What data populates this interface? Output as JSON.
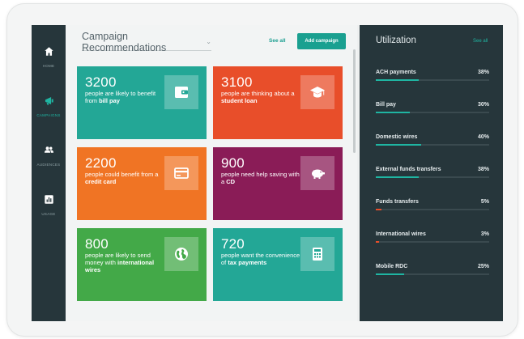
{
  "sidebar": {
    "items": [
      {
        "label": "HOME",
        "icon": "home-icon"
      },
      {
        "label": "CAMPAIGNS",
        "icon": "campaign-icon"
      },
      {
        "label": "AUDIENCES",
        "icon": "audience-icon"
      },
      {
        "label": "USAGE",
        "icon": "usage-icon"
      }
    ]
  },
  "main": {
    "title": "Campaign Recommendations",
    "see_all": "See all",
    "add_button": "Add campaign",
    "cards": [
      {
        "number": "3200",
        "text_pre": "people are likely to benefit from ",
        "text_bold": "bill pay",
        "text_post": "",
        "color": "#23a796",
        "icon": "wallet-icon"
      },
      {
        "number": "3100",
        "text_pre": "people are thinking about a ",
        "text_bold": "student loan",
        "text_post": "",
        "color": "#e84e2a",
        "icon": "graduation-cap-icon"
      },
      {
        "number": "2200",
        "text_pre": "people could benefit from a ",
        "text_bold": "credit card",
        "text_post": "",
        "color": "#f07424",
        "icon": "credit-card-icon"
      },
      {
        "number": "900",
        "text_pre": "people need help saving with a ",
        "text_bold": "CD",
        "text_post": "",
        "color": "#8a1c57",
        "icon": "piggy-bank-icon"
      },
      {
        "number": "800",
        "text_pre": "people are likely to send money with ",
        "text_bold": "international wires",
        "text_post": "",
        "color": "#43a948",
        "icon": "globe-icon"
      },
      {
        "number": "720",
        "text_pre": "people want the convenience of ",
        "text_bold": "tax payments",
        "text_post": "",
        "color": "#23a796",
        "icon": "calculator-icon"
      }
    ]
  },
  "utilization": {
    "title": "Utilization",
    "see_all": "See all",
    "rows": [
      {
        "label": "ACH payments",
        "value": "38%",
        "fill": 0.38,
        "color": "#1fb5a2"
      },
      {
        "label": "Bill pay",
        "value": "30%",
        "fill": 0.3,
        "color": "#1fb5a2"
      },
      {
        "label": "Domestic wires",
        "value": "40%",
        "fill": 0.4,
        "color": "#1fb5a2"
      },
      {
        "label": "External funds transfers",
        "value": "38%",
        "fill": 0.38,
        "color": "#1fb5a2"
      },
      {
        "label": "Funds transfers",
        "value": "5%",
        "fill": 0.05,
        "color": "#e84e2a"
      },
      {
        "label": "International wires",
        "value": "3%",
        "fill": 0.03,
        "color": "#e84e2a"
      },
      {
        "label": "Mobile RDC",
        "value": "25%",
        "fill": 0.25,
        "color": "#1fb5a2"
      }
    ]
  }
}
